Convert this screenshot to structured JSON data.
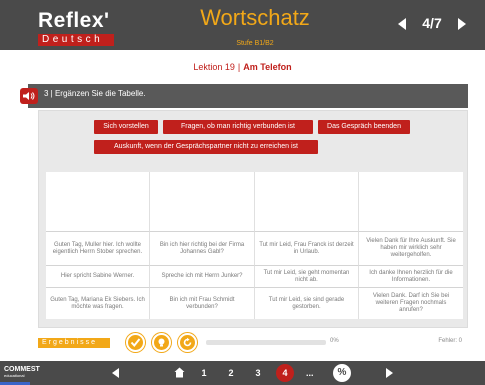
{
  "header": {
    "logo_word": "Reflex'",
    "logo_sub": "Deutsch",
    "title": "Wortschatz",
    "subtitle": "Stufe B1/B2",
    "pager": "4/7"
  },
  "lesson": {
    "prefix": "Lektion 19",
    "separator": "|",
    "topic": "Am Telefon"
  },
  "task": {
    "text": "3 | Ergänzen Sie die Tabelle."
  },
  "chips": [
    "Sich vorstellen",
    "Fragen, ob man richtig verbunden ist",
    "Das Gespräch beenden",
    "Auskunft, wenn der Gesprächspartner nicht zu erreichen ist"
  ],
  "table_rows": [
    [
      "Guten Tag, Muller hier. Ich wollte eigentlich Herrn Stober sprechen.",
      "Bin ich hier richtig bei der Firma Johannes Gabl?",
      "Tut mir Leid, Frau Franck ist derzeit in Urlaub.",
      "Vielen Dank für Ihre Auskunft. Sie haben mir wirklich sehr weitergeholfen."
    ],
    [
      "Hier spricht Sabine Werner.",
      "Spreche ich mit Herrn Junker?",
      "Tut mir Leid, sie geht momentan nicht ab.",
      "Ich danke Ihnen herzlich für die Informationen."
    ],
    [
      "Guten Tag, Mariana Ek Siebers. Ich möchte was fragen.",
      "Bin ich mit Frau Schmidt verbunden?",
      "Tut mir Leid, sie sind gerade gestorben.",
      "Vielen Dank. Darf ich Sie bei weiteren Fragen nochmals anrufen?"
    ]
  ],
  "controls": {
    "result_label": "Ergebnisse",
    "progress_fraction": 0.0,
    "progress_text": "0%",
    "errors_text": "Fehler: 0"
  },
  "footer": {
    "brand": "COMMEST",
    "brand_sub": "educational",
    "pages": [
      "1",
      "2",
      "3",
      "4"
    ],
    "current_page": "4",
    "more": "...",
    "percent_symbol": "%"
  },
  "colors": {
    "accent_red": "#c0201c",
    "accent_orange": "#f2a818",
    "bar_gray": "#4a4a4a"
  },
  "icons": {
    "speaker": "speaker-icon",
    "check": "check-icon",
    "hint": "lightbulb-icon",
    "reset": "reset-icon",
    "home": "home-icon"
  }
}
